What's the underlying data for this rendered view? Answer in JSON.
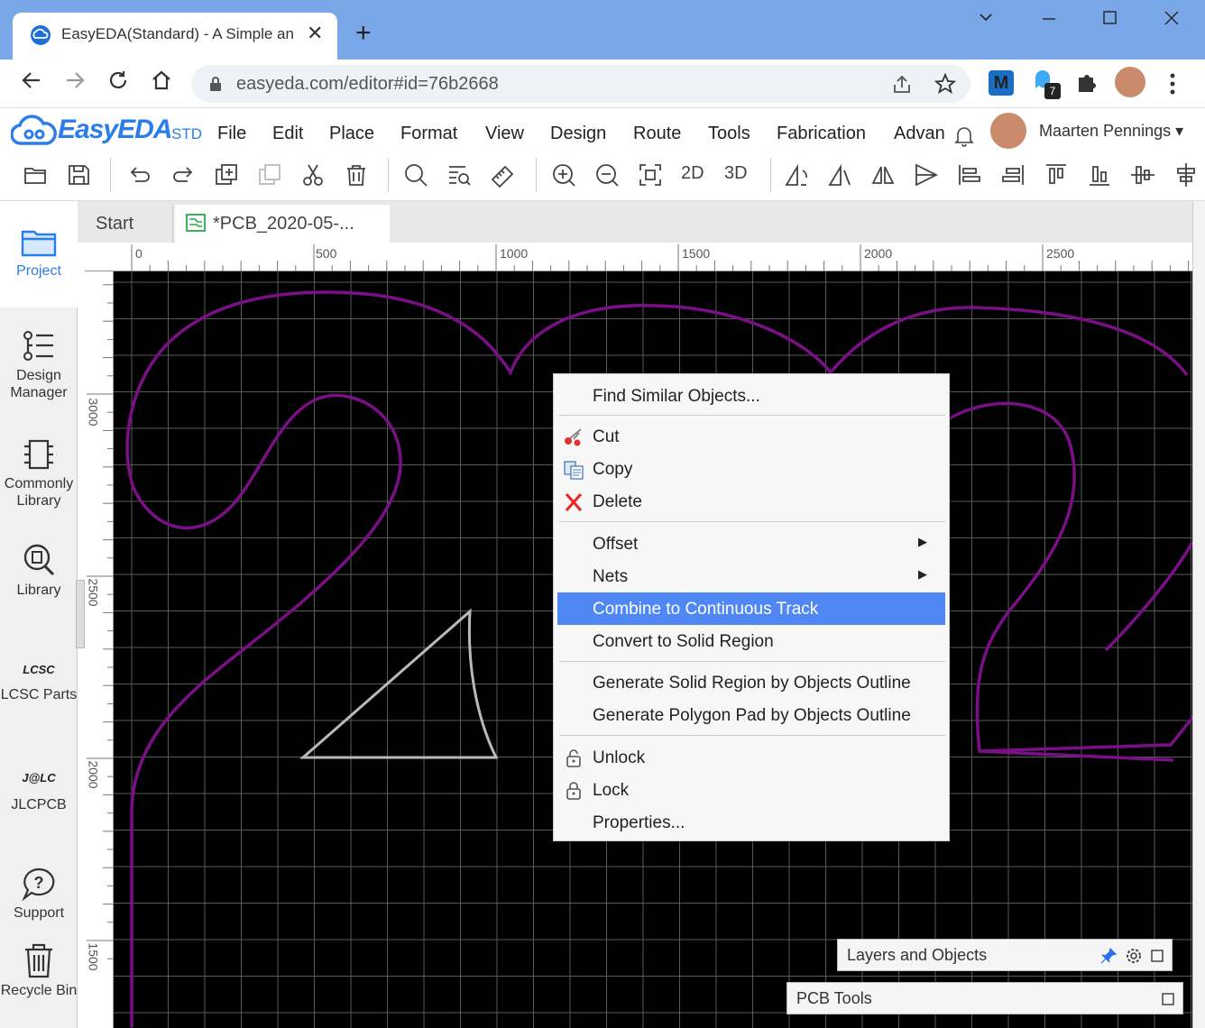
{
  "browser": {
    "tab_title": "EasyEDA(Standard) - A Simple an",
    "url": "easyeda.com/editor#id=76b2668",
    "close_glyph": "✕",
    "new_tab_glyph": "+",
    "extension_badge": "7",
    "extension_m": "M"
  },
  "app": {
    "logo": "EasyEDA",
    "logo_suffix": "STD",
    "menu": [
      "File",
      "Edit",
      "Place",
      "Format",
      "View",
      "Design",
      "Route",
      "Tools",
      "Fabrication",
      "Advan"
    ],
    "user": "Maarten Pennings ▾",
    "toolbar_text": {
      "view2d": "2D",
      "view3d": "3D"
    }
  },
  "sidebar": {
    "items": [
      {
        "label": "Project",
        "icon": "folder-icon"
      },
      {
        "label": "Design Manager",
        "icon": "list-icon"
      },
      {
        "label": "Commonly Library",
        "icon": "chip-icon"
      },
      {
        "label": "Library",
        "icon": "search-chip-icon"
      },
      {
        "label": "LCSC Parts",
        "icon": "lcsc-icon"
      },
      {
        "label": "JLCPCB",
        "icon": "jlc-icon"
      },
      {
        "label": "Support",
        "icon": "help-icon"
      },
      {
        "label": "Recycle Bin",
        "icon": "trash-icon"
      }
    ],
    "lcsc_logo": "LCSC",
    "jlc_logo": "J@LC"
  },
  "doc_tabs": {
    "start": "Start",
    "pcb": "*PCB_2020-05-..."
  },
  "ruler": {
    "top_labels": [
      "0",
      "500",
      "1000",
      "1500",
      "2000",
      "2500"
    ],
    "left_labels": [
      "3000",
      "2500",
      "2000",
      "1500"
    ]
  },
  "context_menu": {
    "items": [
      {
        "label": "Find Similar Objects..."
      },
      {
        "label": "Cut",
        "icon": "scissors-icon"
      },
      {
        "label": "Copy",
        "icon": "copy-icon"
      },
      {
        "label": "Delete",
        "icon": "delete-x-icon"
      },
      {
        "label": "Offset",
        "submenu": true
      },
      {
        "label": "Nets",
        "submenu": true
      },
      {
        "label": "Combine to Continuous Track",
        "highlighted": true
      },
      {
        "label": "Convert to Solid Region"
      },
      {
        "label": "Generate Solid Region by Objects Outline"
      },
      {
        "label": "Generate Polygon Pad by Objects Outline"
      },
      {
        "label": "Unlock",
        "icon": "unlock-icon"
      },
      {
        "label": "Lock",
        "icon": "lock-icon"
      },
      {
        "label": "Properties..."
      }
    ],
    "submenu_arrow": "▶"
  },
  "panels": {
    "layers": "Layers and Objects",
    "pcb_tools": "PCB Tools"
  },
  "colors": {
    "accent": "#2b7de9",
    "highlight": "#4f88f5",
    "track_purple": "#7a0f86",
    "selected_gray": "#b9b9b9",
    "grid": "#5a5a5a"
  }
}
